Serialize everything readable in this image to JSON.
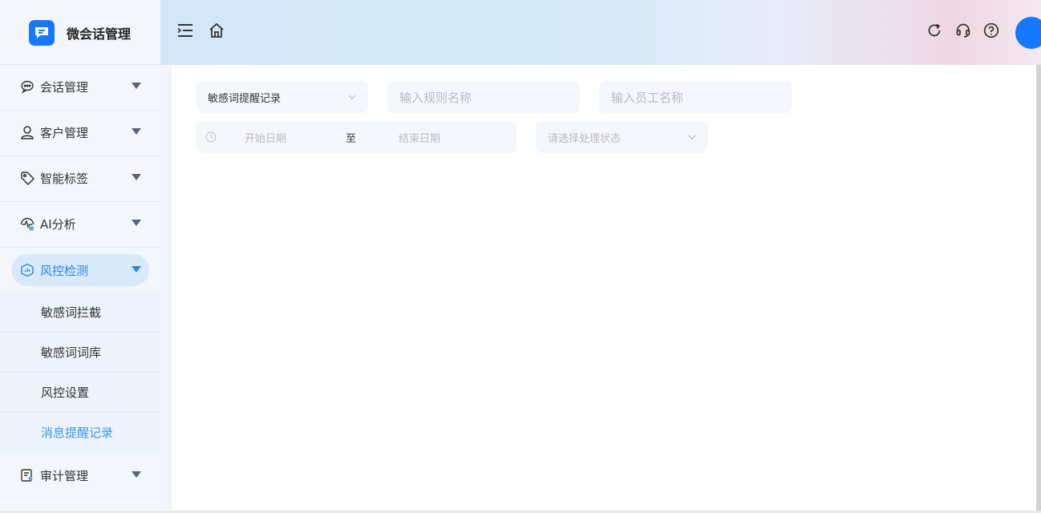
{
  "app": {
    "name": "微会话管理"
  },
  "sidebar": {
    "menu": [
      {
        "label": "会话管理",
        "icon": "chat-icon"
      },
      {
        "label": "客户管理",
        "icon": "user-icon"
      },
      {
        "label": "智能标签",
        "icon": "tag-icon"
      },
      {
        "label": "AI分析",
        "icon": "ai-analysis-icon"
      },
      {
        "label": "风控检测",
        "icon": "shield-icon",
        "active": true
      },
      {
        "label": "审计管理",
        "icon": "audit-icon"
      }
    ],
    "submenu": [
      {
        "label": "敏感词拦截"
      },
      {
        "label": "敏感词词库"
      },
      {
        "label": "风控设置"
      },
      {
        "label": "消息提醒记录",
        "active": true
      }
    ]
  },
  "header": {
    "left_icons": [
      "menu-fold-icon",
      "home-icon"
    ],
    "right_icons": [
      "refresh-icon",
      "headset-icon",
      "help-icon"
    ]
  },
  "filters": {
    "record_type": {
      "value": "敏感词提醒记录"
    },
    "rule_name": {
      "placeholder": "输入规则名称"
    },
    "employee_name": {
      "placeholder": "输入员工名称"
    },
    "date_range": {
      "start_placeholder": "开始日期",
      "separator": "至",
      "end_placeholder": "结束日期"
    },
    "status": {
      "placeholder": "请选择处理状态"
    }
  },
  "colors": {
    "accent": "#1677ff",
    "active_text": "#2b86e0",
    "active_bg": "#d7e9fb"
  }
}
